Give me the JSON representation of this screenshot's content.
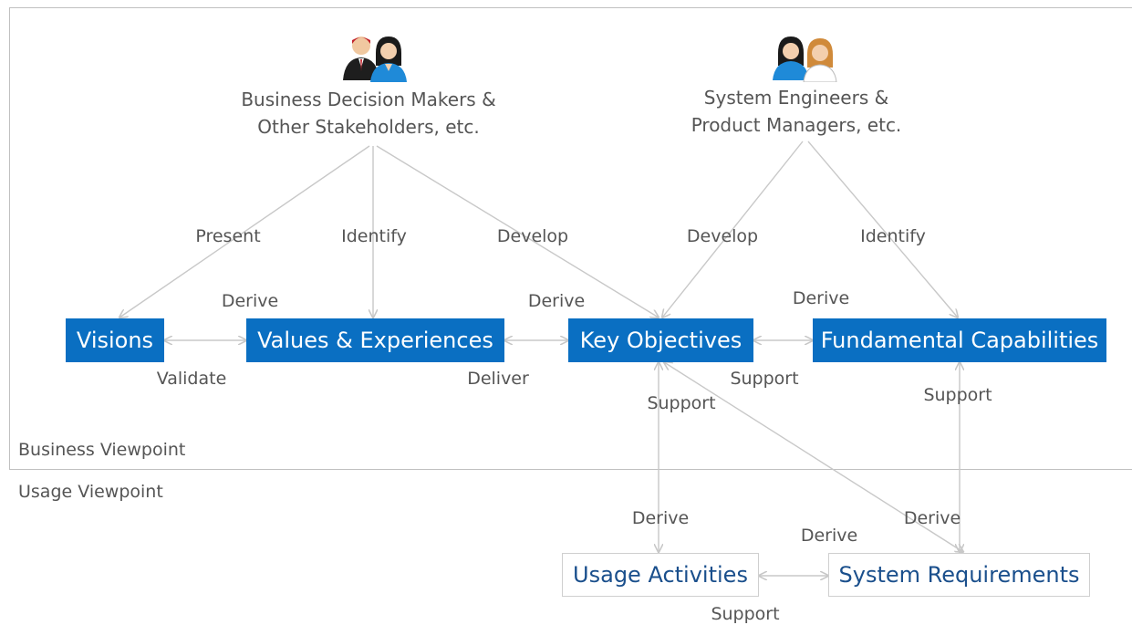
{
  "regions": {
    "business": "Business Viewpoint",
    "usage": "Usage Viewpoint"
  },
  "stakeholders": {
    "business": {
      "line1": "Business Decision Makers &",
      "line2": "Other Stakeholders, etc.",
      "icon": "people-icon"
    },
    "engineering": {
      "line1": "System Engineers &",
      "line2": "Product Managers, etc.",
      "icon": "people-icon"
    }
  },
  "boxes": {
    "visions": "Visions",
    "values": "Values & Experiences",
    "objectives": "Key Objectives",
    "capabilities": "Fundamental Capabilities",
    "usage_activities": "Usage Activities",
    "system_requirements": "System Requirements"
  },
  "edge_labels": {
    "present": "Present",
    "identify_values": "Identify",
    "develop_objectives_business": "Develop",
    "develop_objectives_engineering": "Develop",
    "identify_capabilities": "Identify",
    "derive_visions_values": "Derive",
    "validate": "Validate",
    "derive_values_objectives": "Derive",
    "deliver": "Deliver",
    "derive_objectives_capabilities": "Derive",
    "support_objectives_capabilities": "Support",
    "support_usage_objectives": "Support",
    "support_capabilities": "Support",
    "derive_usage_activities": "Derive",
    "derive_system_requirements": "Derive",
    "derive_usage_requirements": "Derive",
    "support_usage_requirements": "Support"
  },
  "colors": {
    "box_blue": "#0a6fc2",
    "box_white_text": "#1a4f8c",
    "label_gray": "#555555",
    "line_gray": "#c8c8c8"
  }
}
